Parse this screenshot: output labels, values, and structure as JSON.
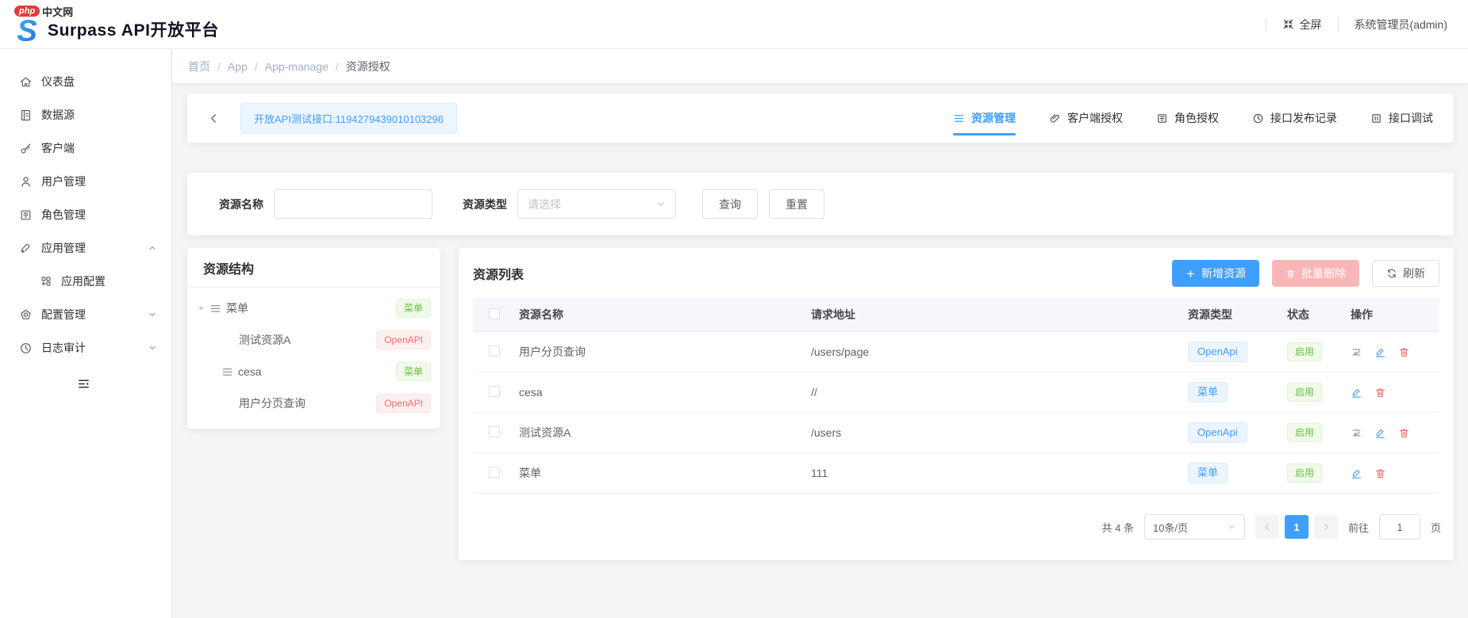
{
  "colors": {
    "primary": "#409eff",
    "success": "#67c23a",
    "danger": "#f56c6c",
    "tag_blue_bg": "#ecf5ff",
    "tag_green_bg": "#f0f9eb",
    "tag_red_bg": "#fef0f0"
  },
  "header": {
    "watermark_php": "php",
    "watermark_site": "中文网",
    "logo_letter": "S",
    "title": "Surpass API开放平台",
    "fullscreen_label": "全屏",
    "user_label": "系统管理员(admin)"
  },
  "sidebar": {
    "items": [
      {
        "label": "仪表盘",
        "icon": "home-icon"
      },
      {
        "label": "数据源",
        "icon": "datasource-icon"
      },
      {
        "label": "客户端",
        "icon": "key-icon"
      },
      {
        "label": "用户管理",
        "icon": "user-icon"
      },
      {
        "label": "角色管理",
        "icon": "role-icon"
      },
      {
        "label": "应用管理",
        "icon": "app-icon",
        "state": "expanded"
      },
      {
        "label": "应用配置",
        "icon": "app-config-icon",
        "sub": true
      },
      {
        "label": "配置管理",
        "icon": "medal-icon",
        "state": "collapsed"
      },
      {
        "label": "日志审计",
        "icon": "clock-icon",
        "state": "collapsed"
      }
    ]
  },
  "breadcrumb": {
    "separator": "/",
    "items": [
      "首页",
      "App",
      "App-manage"
    ],
    "current": "资源授权"
  },
  "toolbar": {
    "api_tag": "开放API测试接口:1194279439010103296"
  },
  "tabs": [
    {
      "label": "资源管理",
      "icon": "menu-icon",
      "active": true
    },
    {
      "label": "客户端授权",
      "icon": "paperclip-icon"
    },
    {
      "label": "角色授权",
      "icon": "picture-icon"
    },
    {
      "label": "接口发布记录",
      "icon": "clock-icon"
    },
    {
      "label": "接口调试",
      "icon": "debug-icon"
    }
  ],
  "filter": {
    "name_label": "资源名称",
    "name_value": "",
    "type_label": "资源类型",
    "type_placeholder": "请选择",
    "search_label": "查询",
    "reset_label": "重置"
  },
  "tree_panel": {
    "title": "资源结构",
    "nodes": [
      {
        "label": "菜单",
        "tag": "菜单"
      },
      {
        "label": "测试资源A",
        "tag": "OpenAPI"
      },
      {
        "label": "cesa",
        "tag": "菜单"
      },
      {
        "label": "用户分页查询",
        "tag": "OpenAPI"
      }
    ]
  },
  "list_panel": {
    "title": "资源列表",
    "buttons": {
      "add": "新增资源",
      "batch_delete": "批量删除",
      "refresh": "刷新"
    },
    "columns": [
      "资源名称",
      "请求地址",
      "资源类型",
      "状态",
      "操作"
    ],
    "rows": [
      {
        "name": "用户分页查询",
        "url": "/users/page",
        "type": "OpenApi",
        "status": "启用"
      },
      {
        "name": "cesa",
        "url": "//",
        "type": "菜单",
        "status": "启用"
      },
      {
        "name": "测试资源A",
        "url": "/users",
        "type": "OpenApi",
        "status": "启用"
      },
      {
        "name": "菜单",
        "url": "111",
        "type": "菜单",
        "status": "启用"
      }
    ],
    "pagination": {
      "total": "共 4 条",
      "page_size": "10条/页",
      "page": "1",
      "goto": "前往",
      "unit": "页",
      "goto_value": "1"
    }
  }
}
